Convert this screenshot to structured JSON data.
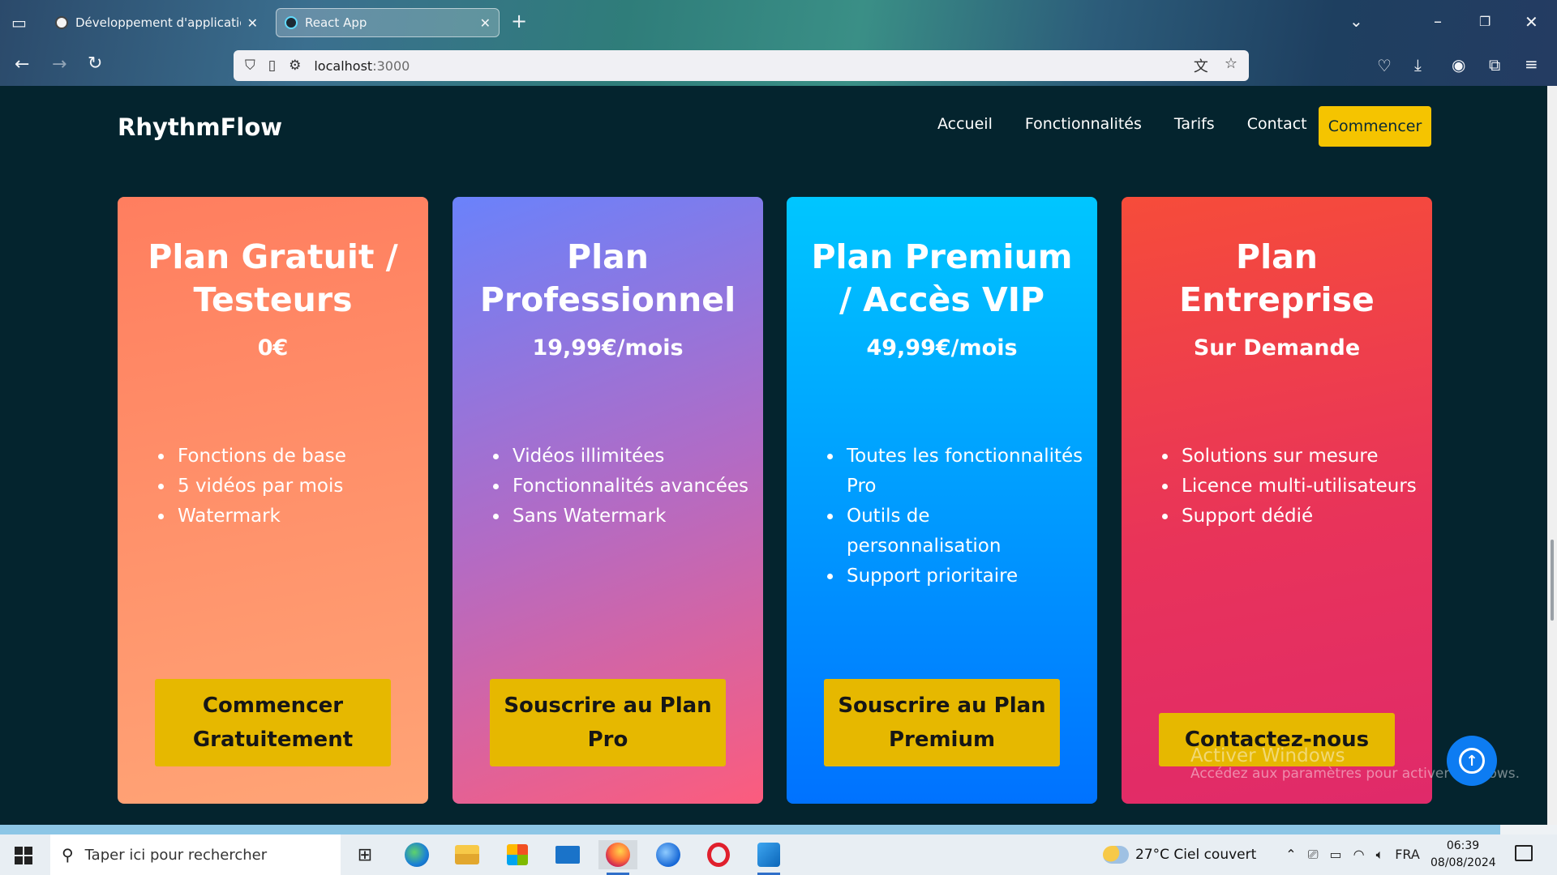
{
  "browser": {
    "tabs": [
      {
        "label": "Développement d'application",
        "active": false
      },
      {
        "label": "React App",
        "active": true
      }
    ],
    "new_tab_icon": "plus-icon",
    "url": {
      "host": "localhost",
      "port": ":3000"
    }
  },
  "site": {
    "brand": "RhythmFlow",
    "nav": [
      "Accueil",
      "Fonctionnalités",
      "Tarifs",
      "Contact"
    ],
    "cta": "Commencer",
    "accent_color": "#f5c400"
  },
  "plans": [
    {
      "title": "Plan Gratuit / Testeurs",
      "price": "0€",
      "features": [
        "Fonctions de base",
        "5 vidéos par mois",
        "Watermark"
      ],
      "button": "Commencer Gratuitement"
    },
    {
      "title": "Plan Professionnel",
      "price": "19,99€/mois",
      "features": [
        "Vidéos illimitées",
        "Fonctionnalités avancées",
        "Sans Watermark"
      ],
      "button": "Souscrire au Plan Pro"
    },
    {
      "title": "Plan Premium / Accès VIP",
      "price": "49,99€/mois",
      "features": [
        "Toutes les fonctionnalités Pro",
        "Outils de personnalisation",
        "Support prioritaire"
      ],
      "button": "Souscrire au Plan Premium"
    },
    {
      "title": "Plan Entreprise",
      "price": "Sur Demande",
      "features": [
        "Solutions sur mesure",
        "Licence multi-utilisateurs",
        "Support dédié"
      ],
      "button": "Contactez-nous"
    }
  ],
  "windows_watermark": {
    "line1": "Activer Windows",
    "line2": "Accédez aux paramètres pour activer Windows."
  },
  "taskbar": {
    "search_placeholder": "Taper ici pour rechercher",
    "weather": "27°C  Ciel couvert",
    "language": "FRA",
    "time": "06:39",
    "date": "08/08/2024"
  }
}
